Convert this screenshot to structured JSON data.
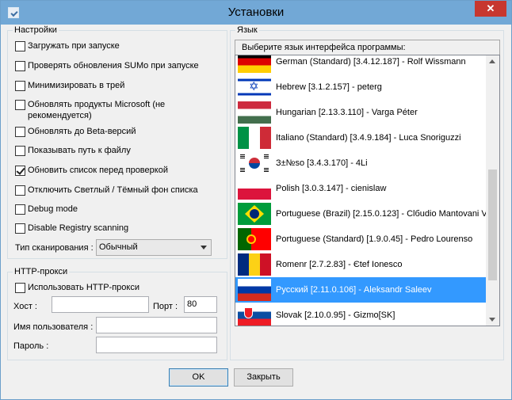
{
  "window": {
    "title": "Установки",
    "close_label": "✕"
  },
  "settings": {
    "group_label": "Настройки",
    "options": [
      {
        "label": "Загружать при запуске",
        "checked": false
      },
      {
        "label": "Проверять обновления SUMo при запуске",
        "checked": false
      },
      {
        "label": "Минимизировать в трей",
        "checked": false
      },
      {
        "label": "Обновлять продукты Microsoft (не рекомендуется)",
        "checked": false
      },
      {
        "label": "Обновлять до Beta-версий",
        "checked": false
      },
      {
        "label": "Показывать путь к файлу",
        "checked": false
      },
      {
        "label": "Обновить список перед проверкой",
        "checked": true
      },
      {
        "label": "Отключить Светлый / Тёмный фон списка",
        "checked": false
      },
      {
        "label": "Debug mode",
        "checked": false
      },
      {
        "label": "Disable Registry scanning",
        "checked": false
      }
    ],
    "scan_type_label": "Тип сканирования :",
    "scan_type_value": "Обычный"
  },
  "proxy": {
    "group_label": "HTTP-прокси",
    "use_proxy_label": "Использовать HTTP-прокси",
    "use_proxy_checked": false,
    "host_label": "Хост :",
    "host_value": "",
    "port_label": "Порт :",
    "port_value": "80",
    "username_label": "Имя пользователя :",
    "username_value": "",
    "password_label": "Пароль :",
    "password_value": ""
  },
  "language": {
    "group_label": "Язык",
    "list_header": "Выберите язык интерфейса программы:",
    "items": [
      {
        "label": "German (Standard) [3.4.12.187] - Rolf Wissmann",
        "flag": "germany-flag-icon",
        "selected": false
      },
      {
        "label": "Hebrew [3.1.2.157] - peterg",
        "flag": "israel-flag-icon",
        "selected": false
      },
      {
        "label": "Hungarian [2.13.3.110] - Varga Péter",
        "flag": "hungary-flag-icon",
        "selected": false
      },
      {
        "label": "Italiano (Standard) [3.4.9.184] - Luca Snoriguzzi",
        "flag": "italy-flag-icon",
        "selected": false
      },
      {
        "label": "З±№so [3.4.3.170] - 4Li",
        "flag": "korea-flag-icon",
        "selected": false
      },
      {
        "label": "Polish [3.0.3.147] - cienislaw",
        "flag": "poland-flag-icon",
        "selected": false
      },
      {
        "label": "Portuguese (Brazil) [2.15.0.123] - Clбudio Mantovani V",
        "flag": "brazil-flag-icon",
        "selected": false
      },
      {
        "label": "Portuguese (Standard) [1.9.0.45] - Pedro Lourenso",
        "flag": "portugal-flag-icon",
        "selected": false
      },
      {
        "label": "Romenr [2.7.2.83] - Єtef Ionesco",
        "flag": "romania-flag-icon",
        "selected": false
      },
      {
        "label": "Русский [2.11.0.106] - Aleksandr Saleev",
        "flag": "russia-flag-icon",
        "selected": true
      },
      {
        "label": "Slovak [2.10.0.95] - Gizmo[SK]",
        "flag": "slovakia-flag-icon",
        "selected": false
      }
    ]
  },
  "buttons": {
    "ok_label": "OK",
    "close_label": "Закрыть"
  },
  "colors": {
    "titlebar": "#72a8d6",
    "selection": "#3399ff",
    "close_button": "#c7372f"
  }
}
